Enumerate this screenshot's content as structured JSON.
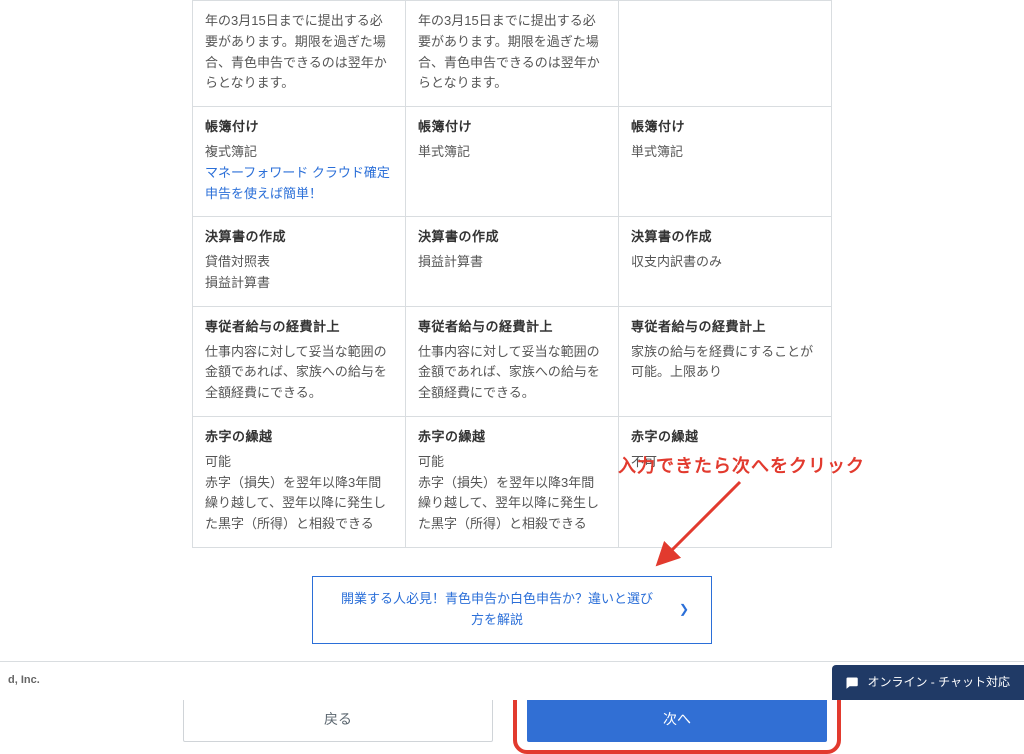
{
  "table": {
    "rows": [
      {
        "cells": [
          {
            "body": "年の3月15日までに提出する必要があります。期限を過ぎた場合、青色申告できるのは翌年からとなります。"
          },
          {
            "body": "年の3月15日までに提出する必要があります。期限を過ぎた場合、青色申告できるのは翌年からとなります。"
          },
          {
            "body": ""
          }
        ]
      },
      {
        "cells": [
          {
            "title": "帳簿付け",
            "body": "複式簿記",
            "link": "マネーフォワード クラウド確定申告を使えば簡単！"
          },
          {
            "title": "帳簿付け",
            "body": "単式簿記"
          },
          {
            "title": "帳簿付け",
            "body": "単式簿記"
          }
        ]
      },
      {
        "cells": [
          {
            "title": "決算書の作成",
            "body": "貸借対照表\n損益計算書"
          },
          {
            "title": "決算書の作成",
            "body": "損益計算書"
          },
          {
            "title": "決算書の作成",
            "body": "収支内訳書のみ"
          }
        ]
      },
      {
        "cells": [
          {
            "title": "専従者給与の経費計上",
            "body": "仕事内容に対して妥当な範囲の金額であれば、家族への給与を全額経費にできる。"
          },
          {
            "title": "専従者給与の経費計上",
            "body": "仕事内容に対して妥当な範囲の金額であれば、家族への給与を全額経費にできる。"
          },
          {
            "title": "専従者給与の経費計上",
            "body": "家族の給与を経費にすることが可能。上限あり"
          }
        ]
      },
      {
        "cells": [
          {
            "title": "赤字の繰越",
            "body": "可能\n赤字（損失）を翌年以降3年間繰り越して、翌年以降に発生した黒字（所得）と相殺できる"
          },
          {
            "title": "赤字の繰越",
            "body": "可能\n赤字（損失）を翌年以降3年間繰り越して、翌年以降に発生した黒字（所得）と相殺できる"
          },
          {
            "title": "赤字の繰越",
            "body": "不可"
          }
        ]
      }
    ]
  },
  "banner": {
    "text": "開業する人必見！青色申告か白色申告か？違いと選び方を解説"
  },
  "annotation": {
    "text": "入力できたら次へをクリック"
  },
  "buttons": {
    "back": "戻る",
    "next": "次へ"
  },
  "footer": {
    "text": "d, Inc."
  },
  "chat": {
    "text": "オンライン - チャット対応"
  }
}
